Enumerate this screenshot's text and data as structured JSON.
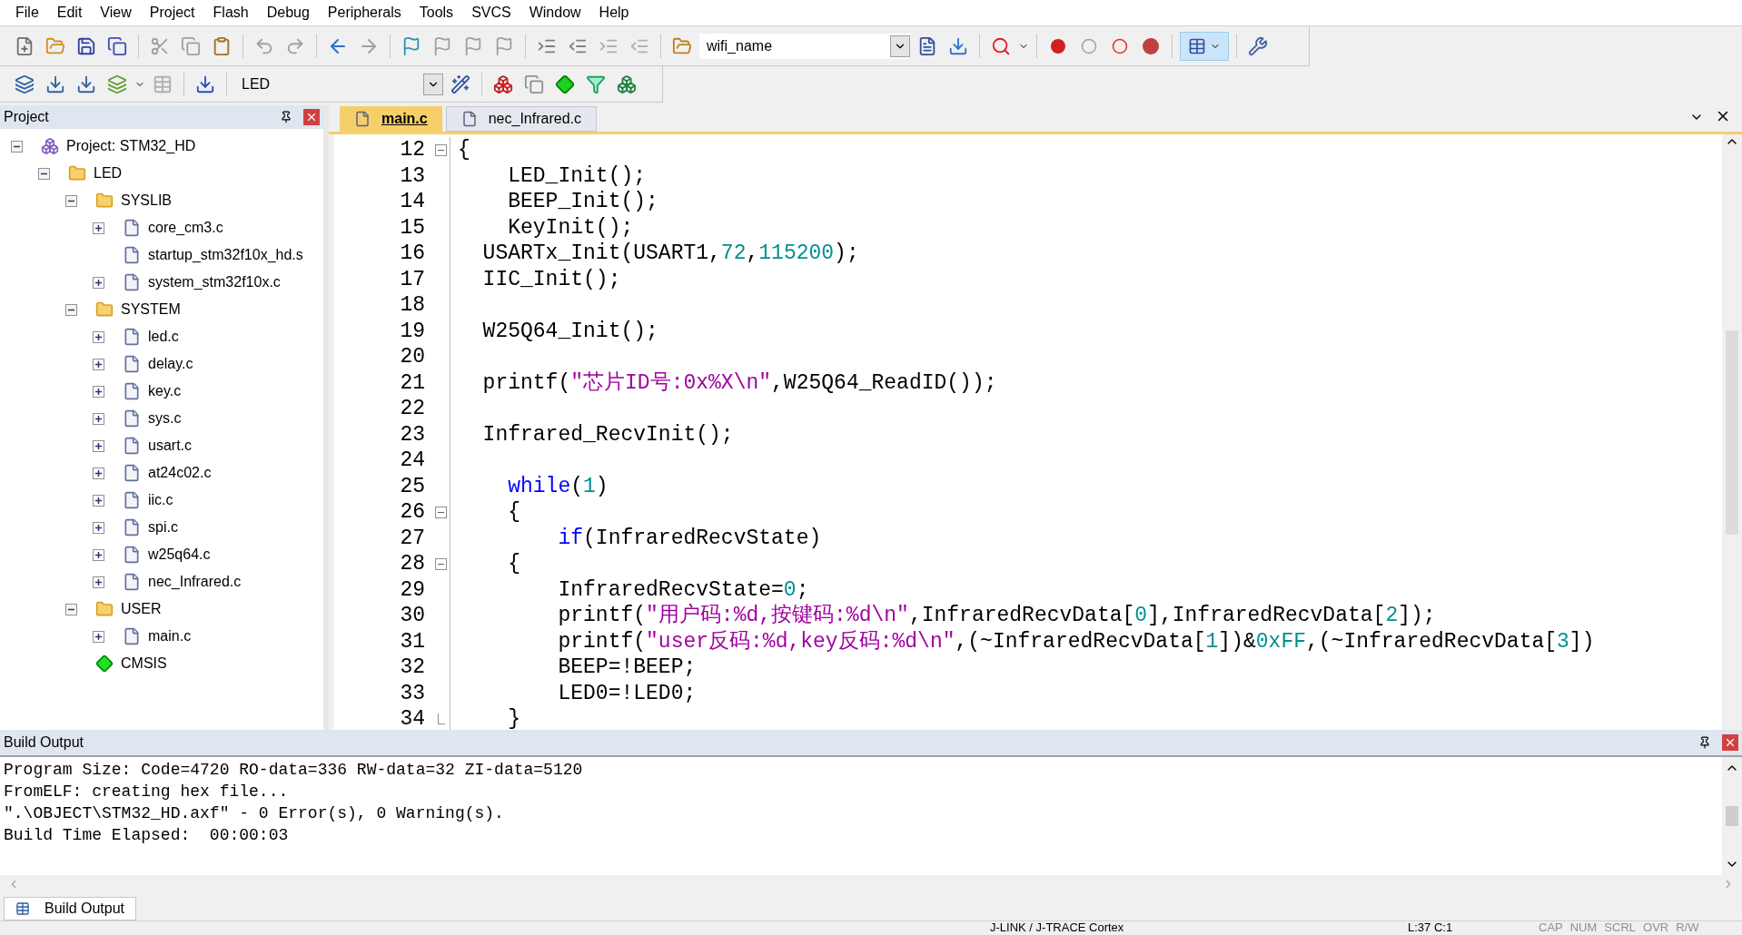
{
  "menu": [
    "File",
    "Edit",
    "View",
    "Project",
    "Flash",
    "Debug",
    "Peripherals",
    "Tools",
    "SVCS",
    "Window",
    "Help"
  ],
  "toolbar": {
    "find_combo": "wifi_name",
    "target_combo": "LED"
  },
  "project_panel": {
    "title": "Project",
    "tree": [
      {
        "label": "Project: STM32_HD",
        "kind": "project",
        "expandable": true,
        "expanded": true,
        "children": [
          {
            "label": "LED",
            "kind": "target",
            "expandable": true,
            "expanded": true,
            "children": [
              {
                "label": "SYSLIB",
                "kind": "group",
                "expandable": true,
                "expanded": true,
                "children": [
                  {
                    "label": "core_cm3.c",
                    "kind": "file",
                    "expandable": true,
                    "expanded": false
                  },
                  {
                    "label": "startup_stm32f10x_hd.s",
                    "kind": "file",
                    "expandable": false
                  },
                  {
                    "label": "system_stm32f10x.c",
                    "kind": "file",
                    "expandable": true,
                    "expanded": false
                  }
                ]
              },
              {
                "label": "SYSTEM",
                "kind": "group",
                "expandable": true,
                "expanded": true,
                "children": [
                  {
                    "label": "led.c",
                    "kind": "file",
                    "expandable": true,
                    "expanded": false
                  },
                  {
                    "label": "delay.c",
                    "kind": "file",
                    "expandable": true,
                    "expanded": false
                  },
                  {
                    "label": "key.c",
                    "kind": "file",
                    "expandable": true,
                    "expanded": false
                  },
                  {
                    "label": "sys.c",
                    "kind": "file",
                    "expandable": true,
                    "expanded": false
                  },
                  {
                    "label": "usart.c",
                    "kind": "file",
                    "expandable": true,
                    "expanded": false
                  },
                  {
                    "label": "at24c02.c",
                    "kind": "file",
                    "expandable": true,
                    "expanded": false
                  },
                  {
                    "label": "iic.c",
                    "kind": "file",
                    "expandable": true,
                    "expanded": false
                  },
                  {
                    "label": "spi.c",
                    "kind": "file",
                    "expandable": true,
                    "expanded": false
                  },
                  {
                    "label": "w25q64.c",
                    "kind": "file",
                    "expandable": true,
                    "expanded": false
                  },
                  {
                    "label": "nec_Infrared.c",
                    "kind": "file",
                    "expandable": true,
                    "expanded": false
                  }
                ]
              },
              {
                "label": "USER",
                "kind": "group",
                "expandable": true,
                "expanded": true,
                "children": [
                  {
                    "label": "main.c",
                    "kind": "file",
                    "expandable": true,
                    "expanded": false
                  }
                ]
              },
              {
                "label": "CMSIS",
                "kind": "component",
                "expandable": false
              }
            ]
          }
        ]
      }
    ]
  },
  "editor": {
    "tabs": [
      {
        "label": "main.c",
        "selected": true
      },
      {
        "label": "nec_Infrared.c",
        "selected": false
      }
    ],
    "lines": [
      {
        "number": "12",
        "fold_start": true,
        "fold_end": false,
        "tokens": [
          {
            "kind": "plain",
            "text": "{"
          }
        ]
      },
      {
        "number": "13",
        "fold_start": false,
        "fold_end": false,
        "tokens": [
          {
            "kind": "plain",
            "text": "    LED_Init();"
          }
        ]
      },
      {
        "number": "14",
        "fold_start": false,
        "fold_end": false,
        "tokens": [
          {
            "kind": "plain",
            "text": "    BEEP_Init();"
          }
        ]
      },
      {
        "number": "15",
        "fold_start": false,
        "fold_end": false,
        "tokens": [
          {
            "kind": "plain",
            "text": "    KeyInit();"
          }
        ]
      },
      {
        "number": "16",
        "fold_start": false,
        "fold_end": false,
        "tokens": [
          {
            "kind": "plain",
            "text": "  USARTx_Init(USART1,"
          },
          {
            "kind": "number",
            "text": "72"
          },
          {
            "kind": "plain",
            "text": ","
          },
          {
            "kind": "number",
            "text": "115200"
          },
          {
            "kind": "plain",
            "text": ");"
          }
        ]
      },
      {
        "number": "17",
        "fold_start": false,
        "fold_end": false,
        "tokens": [
          {
            "kind": "plain",
            "text": "  IIC_Init();"
          }
        ]
      },
      {
        "number": "18",
        "fold_start": false,
        "fold_end": false
      },
      {
        "number": "19",
        "fold_start": false,
        "fold_end": false,
        "tokens": [
          {
            "kind": "plain",
            "text": "  W25Q64_Init();"
          }
        ]
      },
      {
        "number": "20",
        "fold_start": false,
        "fold_end": false
      },
      {
        "number": "21",
        "fold_start": false,
        "fold_end": false,
        "tokens": [
          {
            "kind": "plain",
            "text": "  printf("
          },
          {
            "kind": "string",
            "text": "\"芯片ID号:0x%X\\n\""
          },
          {
            "kind": "plain",
            "text": ",W25Q64_ReadID());"
          }
        ]
      },
      {
        "number": "22",
        "fold_start": false,
        "fold_end": false
      },
      {
        "number": "23",
        "fold_start": false,
        "fold_end": false,
        "tokens": [
          {
            "kind": "plain",
            "text": "  Infrared_RecvInit();"
          }
        ]
      },
      {
        "number": "24",
        "fold_start": false,
        "fold_end": false
      },
      {
        "number": "25",
        "fold_start": false,
        "fold_end": false,
        "tokens": [
          {
            "kind": "keyword",
            "text": "    while"
          },
          {
            "kind": "plain",
            "text": "("
          },
          {
            "kind": "number",
            "text": "1"
          },
          {
            "kind": "plain",
            "text": ")"
          }
        ]
      },
      {
        "number": "26",
        "fold_start": true,
        "fold_end": false,
        "tokens": [
          {
            "kind": "plain",
            "text": "    {"
          }
        ]
      },
      {
        "number": "27",
        "fold_start": false,
        "fold_end": false,
        "tokens": [
          {
            "kind": "keyword",
            "text": "        if"
          },
          {
            "kind": "plain",
            "text": "(InfraredRecvState)"
          }
        ]
      },
      {
        "number": "28",
        "fold_start": true,
        "fold_end": false,
        "tokens": [
          {
            "kind": "plain",
            "text": "    {"
          }
        ]
      },
      {
        "number": "29",
        "fold_start": false,
        "fold_end": false,
        "tokens": [
          {
            "kind": "plain",
            "text": "        InfraredRecvState="
          },
          {
            "kind": "number",
            "text": "0"
          },
          {
            "kind": "plain",
            "text": ";"
          }
        ]
      },
      {
        "number": "30",
        "fold_start": false,
        "fold_end": false,
        "tokens": [
          {
            "kind": "plain",
            "text": "        printf("
          },
          {
            "kind": "string",
            "text": "\"用户码:%d,按键码:%d\\n\""
          },
          {
            "kind": "plain",
            "text": ",InfraredRecvData["
          },
          {
            "kind": "number",
            "text": "0"
          },
          {
            "kind": "plain",
            "text": "],InfraredRecvData["
          },
          {
            "kind": "number",
            "text": "2"
          },
          {
            "kind": "plain",
            "text": "]);"
          }
        ]
      },
      {
        "number": "31",
        "fold_start": false,
        "fold_end": false,
        "tokens": [
          {
            "kind": "plain",
            "text": "        printf("
          },
          {
            "kind": "string",
            "text": "\"user反码:%d,key反码:%d\\n\""
          },
          {
            "kind": "plain",
            "text": ",(~InfraredRecvData["
          },
          {
            "kind": "number",
            "text": "1"
          },
          {
            "kind": "plain",
            "text": "])&"
          },
          {
            "kind": "number",
            "text": "0xFF"
          },
          {
            "kind": "plain",
            "text": ",(~InfraredRecvData["
          },
          {
            "kind": "number",
            "text": "3"
          },
          {
            "kind": "plain",
            "text": "])"
          }
        ]
      },
      {
        "number": "32",
        "fold_start": false,
        "fold_end": false,
        "tokens": [
          {
            "kind": "plain",
            "text": "        BEEP=!BEEP;"
          }
        ]
      },
      {
        "number": "33",
        "fold_start": false,
        "fold_end": false,
        "tokens": [
          {
            "kind": "plain",
            "text": "        LED0=!LED0;"
          }
        ]
      },
      {
        "number": "34",
        "fold_start": false,
        "fold_end": true,
        "tokens": [
          {
            "kind": "plain",
            "text": "    }"
          }
        ]
      }
    ]
  },
  "build_output": {
    "title": "Build Output",
    "lines": [
      "Program Size: Code=4720 RO-data=336 RW-data=32 ZI-data=5120",
      "FromELF: creating hex file...",
      "\".\\OBJECT\\STM32_HD.axf\" - 0 Error(s), 0 Warning(s).",
      "Build Time Elapsed:  00:00:03"
    ]
  },
  "bottom_tabs": [
    {
      "label": "Build Output",
      "selected": true
    }
  ],
  "status_bar": {
    "debugger": "J-LINK / J-TRACE Cortex",
    "position": "L:37 C:1",
    "indicators": [
      "CAP",
      "NUM",
      "SCRL",
      "OVR",
      "R/W"
    ]
  }
}
